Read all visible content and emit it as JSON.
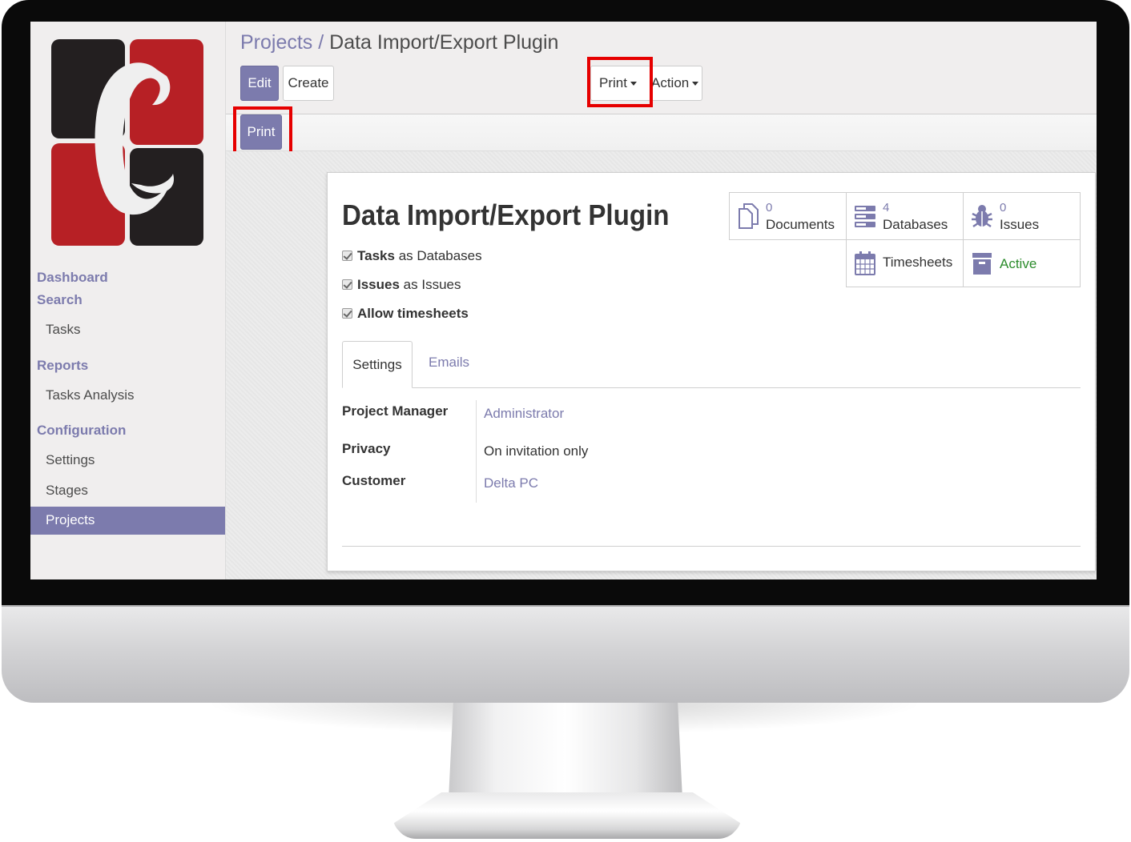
{
  "breadcrumb": {
    "parent": "Projects /",
    "current": "Data Import/Export Plugin"
  },
  "toolbar": {
    "edit": "Edit",
    "create": "Create",
    "print": "Print",
    "action": "Action"
  },
  "statusbar": {
    "print": "Print"
  },
  "sidebar": {
    "dashboard": "Dashboard",
    "search": "Search",
    "tasks": "Tasks",
    "reports": "Reports",
    "tasks_analysis": "Tasks Analysis",
    "configuration": "Configuration",
    "settings": "Settings",
    "stages": "Stages",
    "projects": "Projects"
  },
  "record": {
    "title": "Data Import/Export Plugin",
    "options": [
      {
        "strong": "Tasks",
        "rest": "as Databases"
      },
      {
        "strong": "Issues",
        "rest": "as Issues"
      },
      {
        "strong": "Allow timesheets",
        "rest": ""
      }
    ],
    "smart_buttons": {
      "documents": {
        "count": "0",
        "label": "Documents",
        "icon": "documents-icon"
      },
      "databases": {
        "count": "4",
        "label": "Databases",
        "icon": "database-icon"
      },
      "issues": {
        "count": "0",
        "label": "Issues",
        "icon": "bug-icon"
      },
      "timesheets": {
        "label": "Timesheets",
        "icon": "calendar-icon"
      },
      "active": {
        "label": "Active",
        "icon": "archive-icon"
      }
    },
    "tabs": {
      "settings": "Settings",
      "emails": "Emails"
    },
    "fields": {
      "manager_label": "Project Manager",
      "manager_value": "Administrator",
      "privacy_label": "Privacy",
      "privacy_value": "On invitation only",
      "customer_label": "Customer",
      "customer_value": "Delta PC"
    }
  },
  "colors": {
    "accent": "#7c7bad",
    "highlight": "#e60000",
    "active_green": "#2c8c2c",
    "logo_red": "#b72025",
    "logo_dark": "#231f20"
  }
}
